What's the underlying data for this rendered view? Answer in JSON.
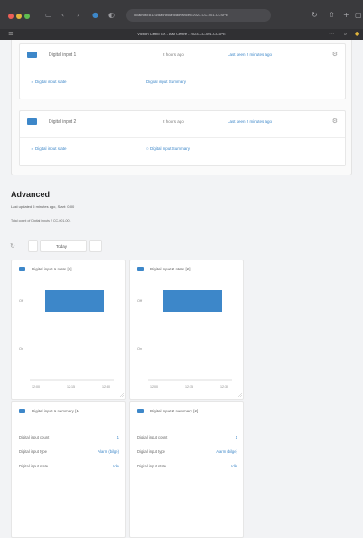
{
  "browser": {
    "url": "localhost:8123/dashboard/advanced/2023-CC-001-CCSPE",
    "tab_title": "Victron Cerbo GX - AIM Centre - 2023-CC-001-CCSPE",
    "icons": [
      "close-icon",
      "minimize-icon",
      "zoom-icon",
      "back-icon",
      "forward-icon",
      "refresh-icon",
      "shield-icon",
      "menu-icon"
    ]
  },
  "entities": [
    {
      "name": "Digital input 1",
      "status": "2 hours ago",
      "time": "Last seen 2 minutes ago",
      "link_left": "Digital input state",
      "link_right": "Digital input Summary"
    },
    {
      "name": "Digital input 2",
      "status": "2 hours ago",
      "time": "Last seen 2 minutes ago",
      "link_left": "Digital input state",
      "link_right": "Digital input Summary"
    }
  ],
  "advanced": {
    "title": "Advanced",
    "sub1": "Last updated 5 minutes ago, Start: 0-00",
    "sub2": "Total count of Digital inputs 2 CC-001-001",
    "toggle_label": "Today"
  },
  "charts": [
    {
      "title": "Digital input 1 state [1]",
      "chart_data": {
        "type": "bar",
        "categories": [
          "Off"
        ],
        "values": [
          1
        ],
        "ytick_labels": [
          "Off",
          "On"
        ],
        "xtick_labels": [
          "12:00",
          "12:15",
          "12:30"
        ]
      }
    },
    {
      "title": "Digital input 2 state [2]",
      "chart_data": {
        "type": "bar",
        "categories": [
          "Off"
        ],
        "values": [
          1
        ],
        "ytick_labels": [
          "Off",
          "On"
        ],
        "xtick_labels": [
          "12:00",
          "12:15",
          "12:30"
        ]
      }
    }
  ],
  "summaries": [
    {
      "title": "Digital input 1 summary [1]",
      "rows": [
        {
          "k": "Digital input count",
          "v": "1"
        },
        {
          "k": "Digital input type",
          "v": "Alarm (bilge)"
        },
        {
          "k": "Digital input state",
          "v": "Idle"
        }
      ]
    },
    {
      "title": "Digital input 2 summary [2]",
      "rows": [
        {
          "k": "Digital input count",
          "v": "1"
        },
        {
          "k": "Digital input type",
          "v": "Alarm (bilge)"
        },
        {
          "k": "Digital input state",
          "v": "Idle"
        }
      ]
    }
  ],
  "colors": {
    "accent": "#3d87c9",
    "page_bg": "#f2f3f5",
    "chrome_bg": "#3a3a3d"
  }
}
